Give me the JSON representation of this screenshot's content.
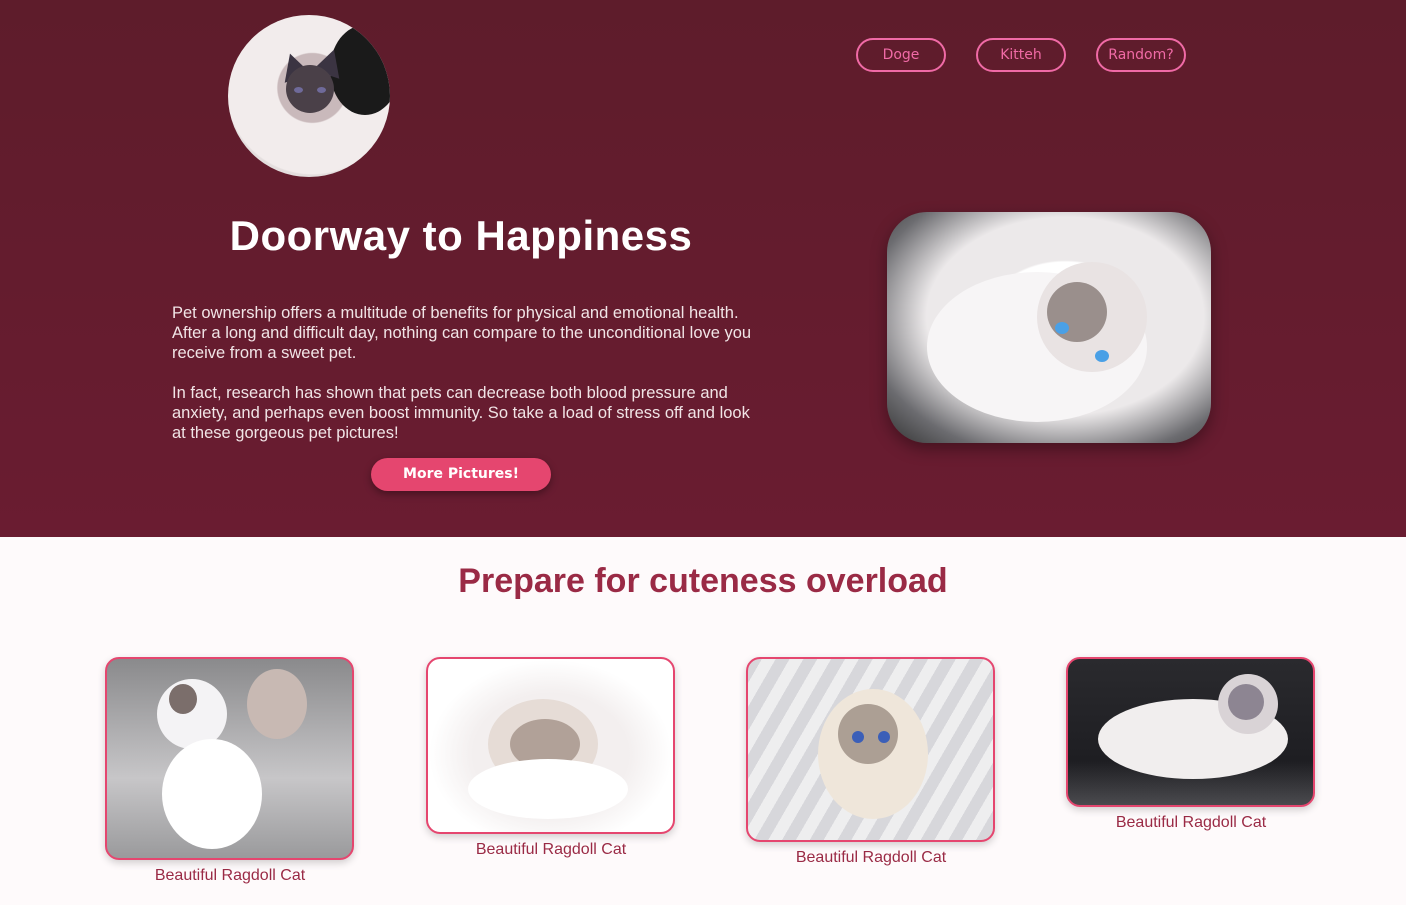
{
  "nav": {
    "items": [
      {
        "label": "Doge"
      },
      {
        "label": "Kitteh"
      },
      {
        "label": "Random?"
      }
    ]
  },
  "hero": {
    "title": "Doorway to Happiness",
    "paragraph1": "Pet ownership offers a multitude of benefits for physical and emotional health. After a long and difficult day, nothing can compare to the unconditional love you receive from a sweet pet.",
    "paragraph2": "In fact, research has shown that pets can decrease both blood pressure and anxiety, and perhaps even boost immunity. So take a load of stress off and look at these gorgeous pet pictures!",
    "cta_label": "More Pictures!"
  },
  "gallery": {
    "title": "Prepare for cuteness overload",
    "cards": [
      {
        "caption": "Beautiful Ragdoll Cat"
      },
      {
        "caption": "Beautiful Ragdoll Cat"
      },
      {
        "caption": "Beautiful Ragdoll Cat"
      },
      {
        "caption": "Beautiful Ragdoll Cat"
      }
    ]
  },
  "colors": {
    "hero_bg": "#651c2e",
    "accent_pink": "#f06aa6",
    "cta_bg": "#e5466f",
    "heading_text": "#9a2a45"
  }
}
